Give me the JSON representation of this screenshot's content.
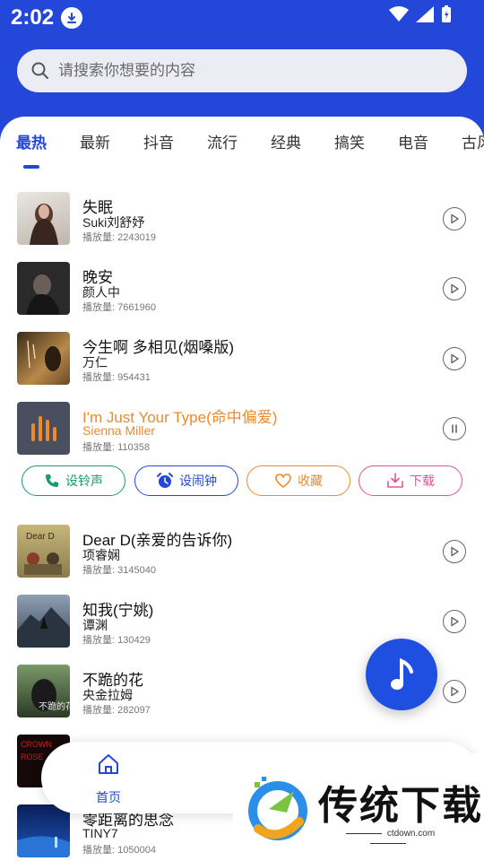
{
  "status_bar": {
    "time": "2:02"
  },
  "search": {
    "placeholder": "请搜索你想要的内容"
  },
  "tabs": [
    {
      "label": "最热",
      "active": true
    },
    {
      "label": "最新"
    },
    {
      "label": "抖音"
    },
    {
      "label": "流行"
    },
    {
      "label": "经典"
    },
    {
      "label": "搞笑"
    },
    {
      "label": "电音"
    },
    {
      "label": "古风"
    }
  ],
  "songs": [
    {
      "title": "失眠",
      "artist": "Suki刘舒妤",
      "plays": "播放量: 2243019"
    },
    {
      "title": "晚安",
      "artist": "颜人中",
      "plays": "播放量: 7661960"
    },
    {
      "title": "今生啊 多相见(烟嗓版)",
      "artist": "万仁",
      "plays": "播放量: 954431"
    },
    {
      "title": "I'm Just Your Type(命中偏爱)",
      "artist": "Sienna Miller",
      "plays": "播放量: 110358",
      "playing": true
    },
    {
      "title": "Dear D(亲爱的告诉你)",
      "artist": "项睿娴",
      "plays": "播放量: 3145040"
    },
    {
      "title": "知我(宁姚)",
      "artist": "谭渊",
      "plays": "播放量: 130429"
    },
    {
      "title": "不跪的花",
      "artist": "央金拉姆",
      "plays": "播放量: 282097"
    },
    {
      "title": "",
      "artist": "",
      "plays": ""
    },
    {
      "title": "零距离的思念",
      "artist": "TINY7",
      "plays": "播放量: 1050004"
    }
  ],
  "actions": {
    "ringtone": "设铃声",
    "alarm": "设闹钟",
    "favorite": "收藏",
    "download": "下载"
  },
  "bottom_nav": {
    "home_label": "首页"
  },
  "watermark": {
    "text": "传统下载",
    "url": "ctdown.com"
  },
  "colors": {
    "primary": "#2348d9",
    "playing": "#ee8a2a",
    "ringtone": "#1a9a6e",
    "alarm": "#2348d9",
    "favorite": "#ee8a2a",
    "download": "#e0539a"
  }
}
